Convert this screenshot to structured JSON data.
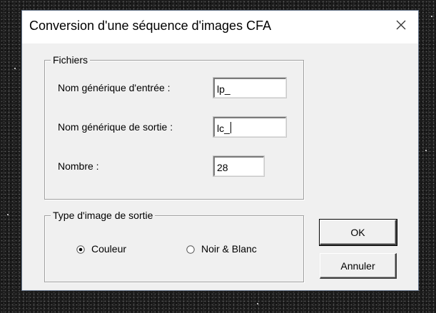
{
  "window": {
    "title": "Conversion d'une séquence d'images CFA",
    "close_icon": "close-icon"
  },
  "files_group": {
    "label": "Fichiers",
    "input_name_label": "Nom générique d'entrée :",
    "input_name_value": "lp_",
    "output_name_label": "Nom générique de sortie :",
    "output_name_value": "lc_",
    "count_label": "Nombre :",
    "count_value": "28"
  },
  "output_type_group": {
    "label": "Type d'image de sortie",
    "options": [
      {
        "label": "Couleur",
        "selected": true
      },
      {
        "label": "Noir & Blanc",
        "selected": false
      }
    ]
  },
  "buttons": {
    "ok_label": "OK",
    "cancel_label": "Annuler"
  },
  "colors": {
    "titlebar": "#ffffff",
    "dialog_bg": "#f0f0f0",
    "desktop_bg": "#1b1b1b"
  }
}
